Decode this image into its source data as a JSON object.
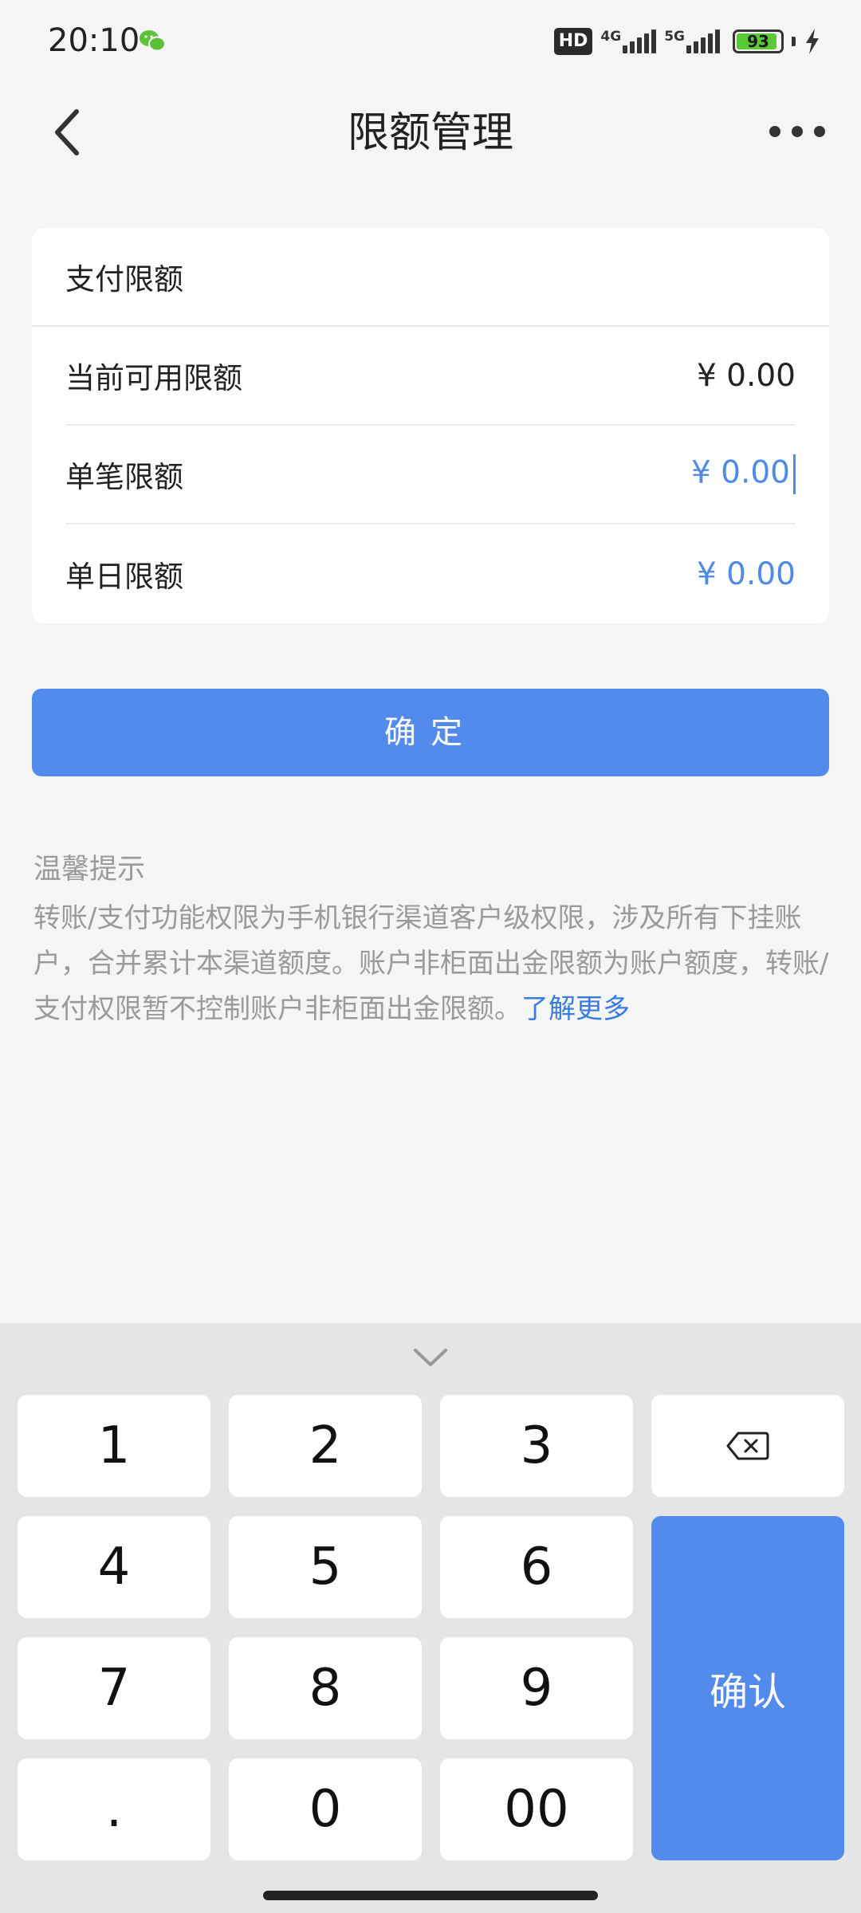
{
  "status_bar": {
    "time": "20:10",
    "notification_icon": "wechat-icon",
    "hd_badge": "HD",
    "network_1": "4G",
    "network_2": "5G",
    "battery_percent": "93",
    "battery_level": 0.93,
    "battery_color": "#5ac935"
  },
  "nav": {
    "title": "限额管理",
    "back_icon": "chevron-left-icon",
    "more_icon": "more-dots-icon"
  },
  "card": {
    "section_title": "支付限额",
    "rows": [
      {
        "label": "当前可用限额",
        "value": "¥ 0.00"
      },
      {
        "label": "单笔限额",
        "value": "¥ 0.00"
      },
      {
        "label": "单日限额",
        "value": "¥ 0.00"
      }
    ]
  },
  "confirm_button": {
    "label": "确定"
  },
  "tips": {
    "title": "温馨提示",
    "body": "转账/支付功能权限为手机银行渠道客户级权限，涉及所有下挂账户，合并累计本渠道额度。账户非柜面出金限额为账户额度，转账/支付权限暂不控制账户非柜面出金限额。",
    "link": "了解更多"
  },
  "keyboard": {
    "collapse_icon": "chevron-down-icon",
    "keys": [
      "1",
      "2",
      "3",
      "4",
      "5",
      "6",
      "7",
      "8",
      "9",
      ".",
      "0",
      "00"
    ],
    "backspace_icon": "backspace-icon",
    "confirm_label": "确认"
  },
  "colors": {
    "accent": "#528bec",
    "link": "#3a7be0",
    "value_blue": "#4f8ae6",
    "background": "#f5f5f5"
  }
}
